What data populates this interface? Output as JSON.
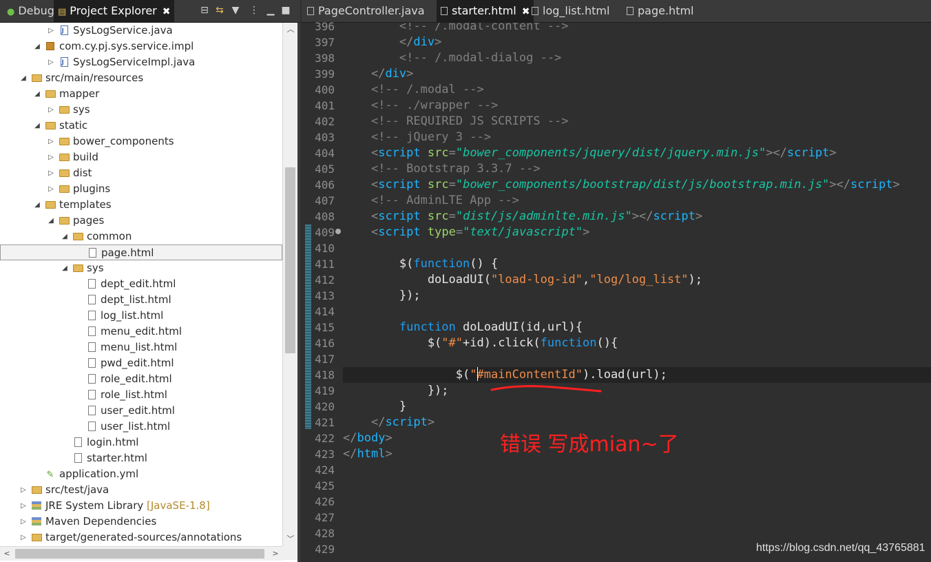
{
  "left_tabs": {
    "debug": "Debug",
    "project_explorer": "Project Explorer"
  },
  "tree": [
    {
      "label": "SysLogService.java",
      "depth": 4,
      "twisty": "▷",
      "icon": "java"
    },
    {
      "label": "com.cy.pj.sys.service.impl",
      "depth": 3,
      "twisty": "◢",
      "icon": "pkg"
    },
    {
      "label": "SysLogServiceImpl.java",
      "depth": 4,
      "twisty": "▷",
      "icon": "java"
    },
    {
      "label": "src/main/resources",
      "depth": 2,
      "twisty": "◢",
      "icon": "srcf"
    },
    {
      "label": "mapper",
      "depth": 3,
      "twisty": "◢",
      "icon": "folder"
    },
    {
      "label": "sys",
      "depth": 4,
      "twisty": "▷",
      "icon": "folder"
    },
    {
      "label": "static",
      "depth": 3,
      "twisty": "◢",
      "icon": "folder"
    },
    {
      "label": "bower_components",
      "depth": 4,
      "twisty": "▷",
      "icon": "folder"
    },
    {
      "label": "build",
      "depth": 4,
      "twisty": "▷",
      "icon": "folder"
    },
    {
      "label": "dist",
      "depth": 4,
      "twisty": "▷",
      "icon": "folder"
    },
    {
      "label": "plugins",
      "depth": 4,
      "twisty": "▷",
      "icon": "folder"
    },
    {
      "label": "templates",
      "depth": 3,
      "twisty": "◢",
      "icon": "folder"
    },
    {
      "label": "pages",
      "depth": 4,
      "twisty": "◢",
      "icon": "folder"
    },
    {
      "label": "common",
      "depth": 5,
      "twisty": "◢",
      "icon": "folder"
    },
    {
      "label": "page.html",
      "depth": 6,
      "twisty": "",
      "icon": "file",
      "selected": true
    },
    {
      "label": "sys",
      "depth": 5,
      "twisty": "◢",
      "icon": "folder"
    },
    {
      "label": "dept_edit.html",
      "depth": 6,
      "twisty": "",
      "icon": "file"
    },
    {
      "label": "dept_list.html",
      "depth": 6,
      "twisty": "",
      "icon": "file"
    },
    {
      "label": "log_list.html",
      "depth": 6,
      "twisty": "",
      "icon": "file"
    },
    {
      "label": "menu_edit.html",
      "depth": 6,
      "twisty": "",
      "icon": "file"
    },
    {
      "label": "menu_list.html",
      "depth": 6,
      "twisty": "",
      "icon": "file"
    },
    {
      "label": "pwd_edit.html",
      "depth": 6,
      "twisty": "",
      "icon": "file"
    },
    {
      "label": "role_edit.html",
      "depth": 6,
      "twisty": "",
      "icon": "file"
    },
    {
      "label": "role_list.html",
      "depth": 6,
      "twisty": "",
      "icon": "file"
    },
    {
      "label": "user_edit.html",
      "depth": 6,
      "twisty": "",
      "icon": "file"
    },
    {
      "label": "user_list.html",
      "depth": 6,
      "twisty": "",
      "icon": "file"
    },
    {
      "label": "login.html",
      "depth": 5,
      "twisty": "",
      "icon": "file"
    },
    {
      "label": "starter.html",
      "depth": 5,
      "twisty": "",
      "icon": "file"
    },
    {
      "label": "application.yml",
      "depth": 3,
      "twisty": "",
      "icon": "yml"
    },
    {
      "label": "src/test/java",
      "depth": 2,
      "twisty": "▷",
      "icon": "srcf"
    },
    {
      "label": "JRE System Library",
      "extra": "[JavaSE-1.8]",
      "depth": 2,
      "twisty": "▷",
      "icon": "lib"
    },
    {
      "label": "Maven Dependencies",
      "depth": 2,
      "twisty": "▷",
      "icon": "lib"
    },
    {
      "label": "target/generated-sources/annotations",
      "depth": 2,
      "twisty": "▷",
      "icon": "srcf"
    }
  ],
  "editor_tabs": [
    {
      "label": "PageController.java",
      "active": false
    },
    {
      "label": "starter.html",
      "active": true
    },
    {
      "label": "log_list.html",
      "active": false
    },
    {
      "label": "page.html",
      "active": false
    }
  ],
  "line_numbers": [
    "396",
    "397",
    "398",
    "399",
    "400",
    "401",
    "402",
    "403",
    "404",
    "405",
    "406",
    "407",
    "408",
    "409",
    "410",
    "411",
    "412",
    "413",
    "414",
    "415",
    "416",
    "417",
    "418",
    "419",
    "420",
    "421",
    "422",
    "423",
    "424",
    "425",
    "426",
    "427",
    "428",
    "429"
  ],
  "code_lines": [
    [
      [
        "cm",
        "        <!-- /.modal-content -->"
      ]
    ],
    [
      [
        "pl",
        "        "
      ],
      [
        "br",
        "</"
      ],
      [
        "tg",
        "div"
      ],
      [
        "br",
        ">"
      ]
    ],
    [
      [
        "pl",
        "        "
      ],
      [
        "cm",
        "<!-- /.modal-dialog -->"
      ]
    ],
    [
      [
        "pl",
        "    "
      ],
      [
        "br",
        "</"
      ],
      [
        "tg",
        "div"
      ],
      [
        "br",
        ">"
      ]
    ],
    [
      [
        "pl",
        "    "
      ],
      [
        "cm",
        "<!-- /.modal -->"
      ]
    ],
    [
      [
        "pl",
        "    "
      ],
      [
        "cm",
        "<!-- ./wrapper -->"
      ]
    ],
    [
      [
        "pl",
        "    "
      ],
      [
        "cm",
        "<!-- REQUIRED JS SCRIPTS -->"
      ]
    ],
    [
      [
        "pl",
        "    "
      ],
      [
        "cm",
        "<!-- jQuery 3 -->"
      ]
    ],
    [
      [
        "pl",
        "    "
      ],
      [
        "br",
        "<"
      ],
      [
        "tg",
        "script"
      ],
      [
        "pl",
        " "
      ],
      [
        "at",
        "src"
      ],
      [
        "br",
        "="
      ],
      [
        "av",
        "\"bower_components/jquery/dist/jquery.min.js\""
      ],
      [
        "br",
        "></"
      ],
      [
        "tg",
        "script"
      ],
      [
        "br",
        ">"
      ]
    ],
    [
      [
        "pl",
        "    "
      ],
      [
        "cm",
        "<!-- Bootstrap 3.3.7 -->"
      ]
    ],
    [
      [
        "pl",
        "    "
      ],
      [
        "br",
        "<"
      ],
      [
        "tg",
        "script"
      ],
      [
        "pl",
        " "
      ],
      [
        "at",
        "src"
      ],
      [
        "br",
        "="
      ],
      [
        "av",
        "\"bower_components/bootstrap/dist/js/bootstrap.min.js\""
      ],
      [
        "br",
        "></"
      ],
      [
        "tg",
        "script"
      ],
      [
        "br",
        ">"
      ]
    ],
    [
      [
        "pl",
        "    "
      ],
      [
        "cm",
        "<!-- AdminLTE App -->"
      ]
    ],
    [
      [
        "pl",
        "    "
      ],
      [
        "br",
        "<"
      ],
      [
        "tg",
        "script"
      ],
      [
        "pl",
        " "
      ],
      [
        "at",
        "src"
      ],
      [
        "br",
        "="
      ],
      [
        "av",
        "\"dist/js/adminlte.min.js\""
      ],
      [
        "br",
        "></"
      ],
      [
        "tg",
        "script"
      ],
      [
        "br",
        ">"
      ]
    ],
    [
      [
        "pl",
        "    "
      ],
      [
        "br",
        "<"
      ],
      [
        "tg",
        "script"
      ],
      [
        "pl",
        " "
      ],
      [
        "at",
        "type"
      ],
      [
        "br",
        "="
      ],
      [
        "av",
        "\"text/javascript\""
      ],
      [
        "br",
        ">"
      ]
    ],
    [
      [
        "pl",
        ""
      ]
    ],
    [
      [
        "pl",
        "        $("
      ],
      [
        "kw",
        "function"
      ],
      [
        "pl",
        "() {"
      ]
    ],
    [
      [
        "pl",
        "            doLoadUI("
      ],
      [
        "st",
        "\"load-log-id\""
      ],
      [
        "pl",
        ","
      ],
      [
        "st",
        "\"log/log_list\""
      ],
      [
        "pl",
        ");"
      ]
    ],
    [
      [
        "pl",
        "        });"
      ]
    ],
    [
      [
        "pl",
        ""
      ]
    ],
    [
      [
        "pl",
        "        "
      ],
      [
        "kw",
        "function"
      ],
      [
        "pl",
        " doLoadUI(id,url){"
      ]
    ],
    [
      [
        "pl",
        "            $("
      ],
      [
        "st",
        "\"#\""
      ],
      [
        "pl",
        "+id).click("
      ],
      [
        "kw",
        "function"
      ],
      [
        "pl",
        "(){"
      ]
    ],
    [
      [
        "pl",
        ""
      ]
    ],
    [
      [
        "pl",
        "                $("
      ],
      [
        "st",
        "\"#mainContentId\""
      ],
      [
        "pl",
        ").load(url);"
      ]
    ],
    [
      [
        "pl",
        "            });"
      ]
    ],
    [
      [
        "pl",
        "        }"
      ]
    ],
    [
      [
        "pl",
        "    "
      ],
      [
        "br",
        "</"
      ],
      [
        "tg",
        "script"
      ],
      [
        "br",
        ">"
      ]
    ],
    [
      [
        "br",
        "</"
      ],
      [
        "tg",
        "body"
      ],
      [
        "br",
        ">"
      ]
    ],
    [
      [
        "br",
        "</"
      ],
      [
        "tg",
        "html"
      ],
      [
        "br",
        ">"
      ]
    ],
    [
      [
        "pl",
        ""
      ]
    ],
    [
      [
        "pl",
        ""
      ]
    ],
    [
      [
        "pl",
        ""
      ]
    ],
    [
      [
        "pl",
        ""
      ]
    ],
    [
      [
        "pl",
        ""
      ]
    ],
    [
      [
        "pl",
        ""
      ]
    ]
  ],
  "annotation": "错误 写成mian~了",
  "watermark": "https://blog.csdn.net/qq_43765881",
  "colors": {
    "annotation": "#ff2020",
    "keyword": "#1f9ef2",
    "tag": "#1eb5ff",
    "string": "#f08d49",
    "comment": "#808080"
  }
}
